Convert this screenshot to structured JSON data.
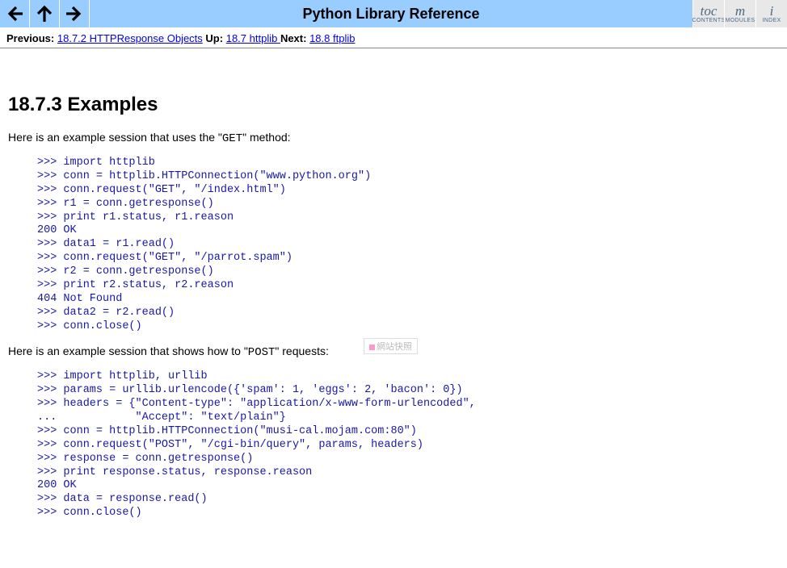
{
  "header": {
    "title": "Python Library Reference",
    "toc_buttons": [
      {
        "big": "toc",
        "small": "CONTENTS"
      },
      {
        "big": "m",
        "small": "MODULES"
      },
      {
        "big": "i",
        "small": "INDEX"
      }
    ]
  },
  "breadcrumb": {
    "prev_label": "Previous:",
    "prev_link": "18.7.2 HTTPResponse Objects",
    "up_label": "Up:",
    "up_link": "18.7 httplib ",
    "next_label": "Next:",
    "next_link": "18.8 ftplib"
  },
  "section": {
    "heading": "18.7.3 Examples",
    "intro1_a": "Here is an example session that uses the \"",
    "intro1_code": "GET",
    "intro1_b": "\" method:",
    "code1": ">>> import httplib\n>>> conn = httplib.HTTPConnection(\"www.python.org\")\n>>> conn.request(\"GET\", \"/index.html\")\n>>> r1 = conn.getresponse()\n>>> print r1.status, r1.reason\n200 OK\n>>> data1 = r1.read()\n>>> conn.request(\"GET\", \"/parrot.spam\")\n>>> r2 = conn.getresponse()\n>>> print r2.status, r2.reason\n404 Not Found\n>>> data2 = r2.read()\n>>> conn.close()",
    "intro2_a": "Here is an example session that shows how to \"",
    "intro2_code": "POST",
    "intro2_b": "\" requests:",
    "code2": ">>> import httplib, urllib\n>>> params = urllib.urlencode({'spam': 1, 'eggs': 2, 'bacon': 0})\n>>> headers = {\"Content-type\": \"application/x-www-form-urlencoded\",\n...            \"Accept\": \"text/plain\"}\n>>> conn = httplib.HTTPConnection(\"musi-cal.mojam.com:80\")\n>>> conn.request(\"POST\", \"/cgi-bin/query\", params, headers)\n>>> response = conn.getresponse()\n>>> print response.status, response.reason\n200 OK\n>>> data = response.read()\n>>> conn.close()"
  },
  "watermark": "網站快照"
}
